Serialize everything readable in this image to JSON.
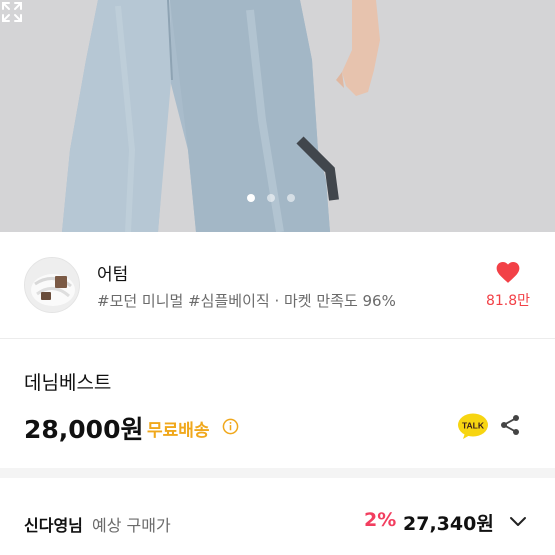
{
  "gallery": {
    "image_name": "denim-pants-photo",
    "dot_count": 3,
    "active_index": 0,
    "expand_icon": "expand-icon"
  },
  "shop": {
    "name": "어텀",
    "tags": "#모던 미니멀 #심플베이직 · 마켓 만족도 96%",
    "avatar_icon": "shop-avatar",
    "like_count": "81.8만",
    "like_icon": "heart-icon",
    "like_color": "#f24147"
  },
  "product": {
    "name": "데님베스트",
    "price": "28,000원",
    "shipping": "무료배송",
    "shipping_color": "#f0a81c",
    "talk_label": "TALK",
    "talk_icon": "kakao-talk-icon",
    "share_icon": "share-icon",
    "info_icon": "info-icon"
  },
  "purchase": {
    "buyer": "신다영님",
    "buyer_sub": "예상 구매가",
    "discount": "2%",
    "discount_color": "#f23e5f",
    "expected_price": "27,340원",
    "chevron_icon": "chevron-down-icon"
  }
}
